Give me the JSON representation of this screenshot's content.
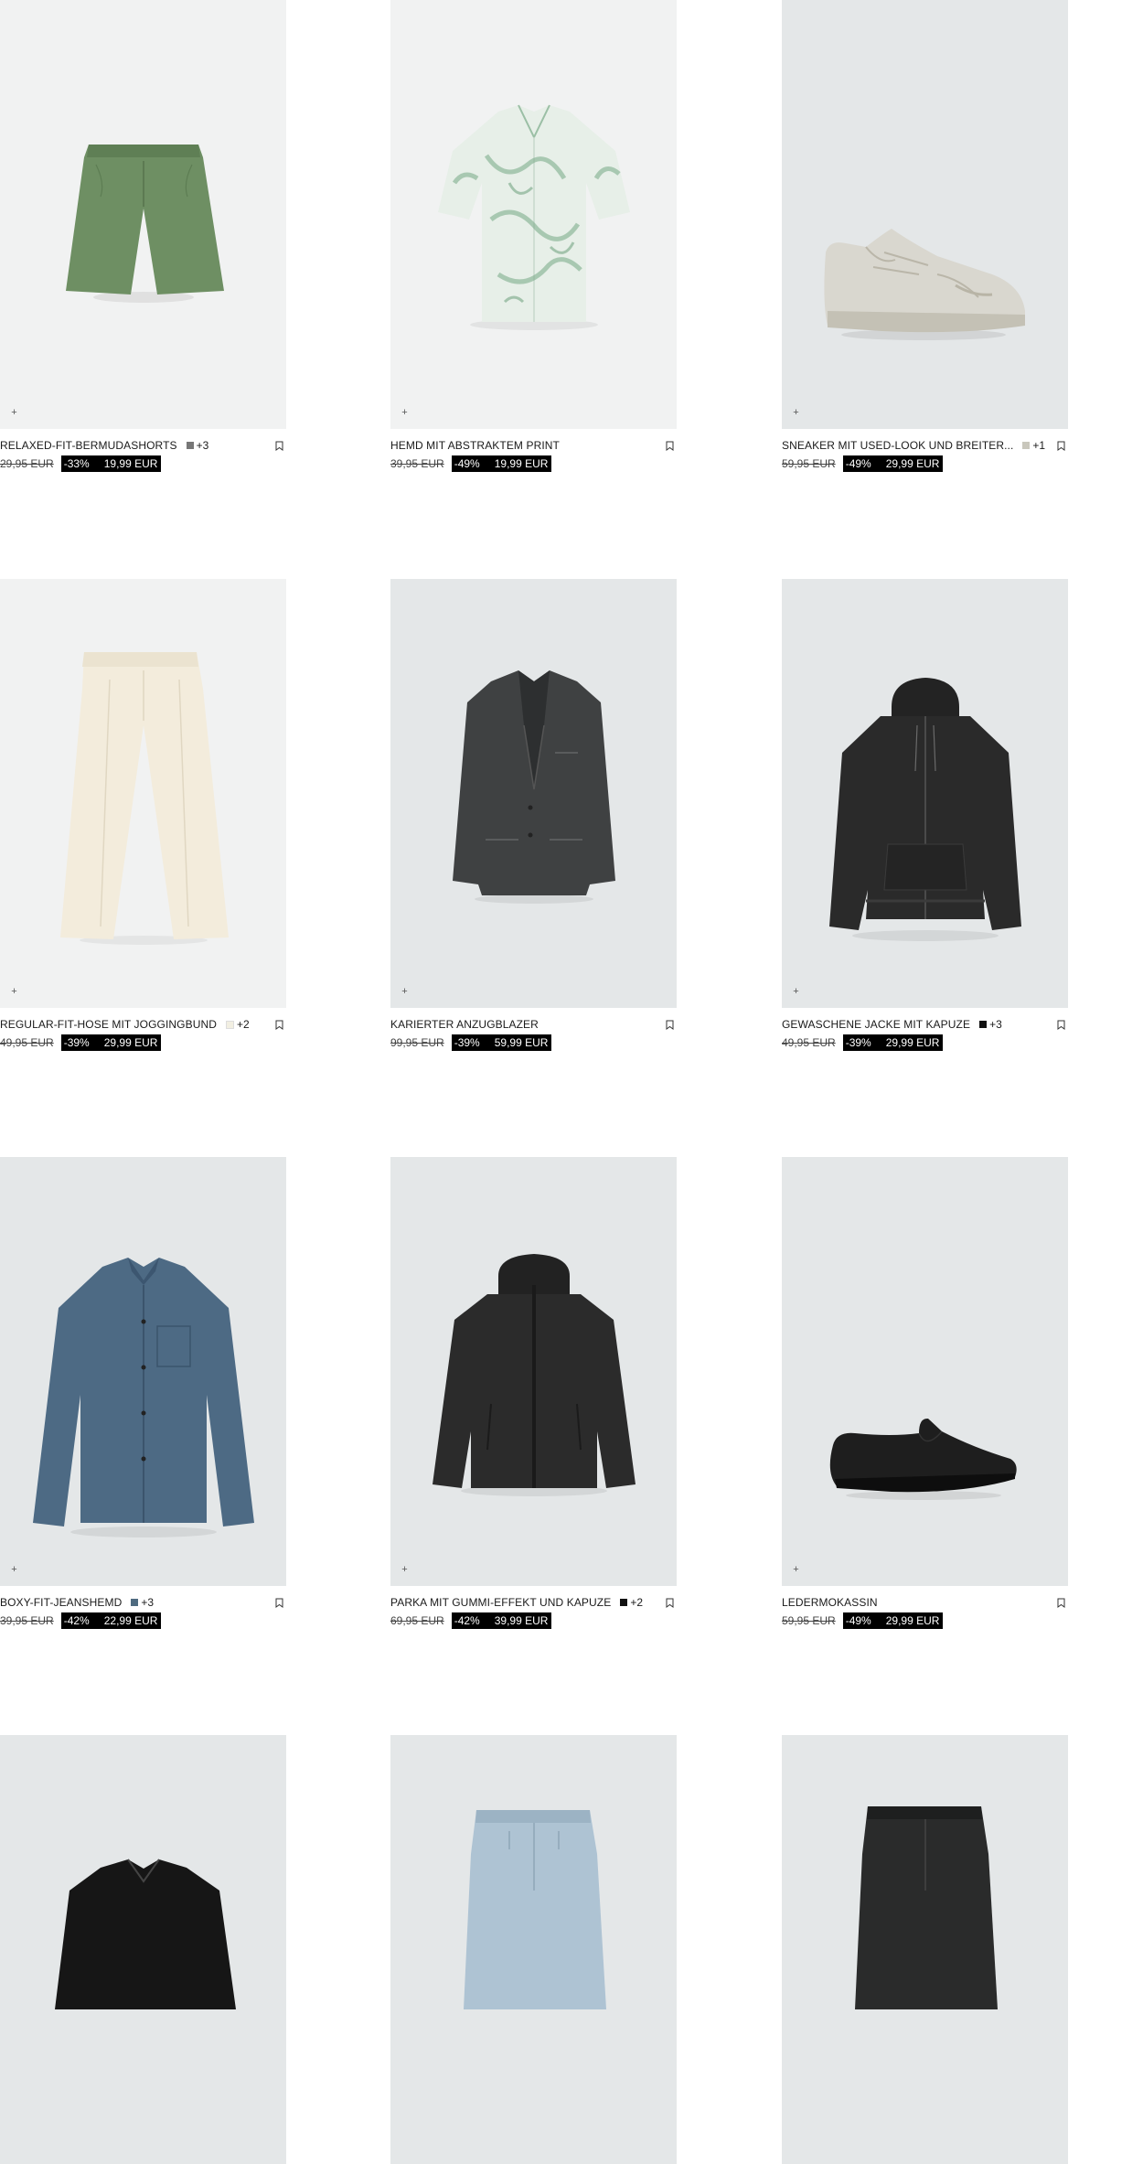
{
  "products": [
    {
      "name": "RELAXED-FIT-BERMUDASHORTS",
      "swatch": "#777777",
      "more": "+3",
      "old": "29,95 EUR",
      "disc": "-33%",
      "now": "19,99 EUR",
      "icon": "plus-icon"
    },
    {
      "name": "HEMD MIT ABSTRAKTEM PRINT",
      "swatch": "",
      "more": "",
      "old": "39,95 EUR",
      "disc": "-49%",
      "now": "19,99 EUR",
      "icon": "plus-icon"
    },
    {
      "name": "SNEAKER MIT USED-LOOK UND BREITER...",
      "swatch": "#c9c7bc",
      "more": "+1",
      "old": "59,95 EUR",
      "disc": "-49%",
      "now": "29,99 EUR",
      "icon": "plus-icon"
    },
    {
      "name": "REGULAR-FIT-HOSE MIT JOGGINGBUND",
      "swatch": "#f2efe2",
      "more": "+2",
      "old": "49,95 EUR",
      "disc": "-39%",
      "now": "29,99 EUR",
      "icon": "plus-icon"
    },
    {
      "name": "KARIERTER ANZUGBLAZER",
      "swatch": "",
      "more": "",
      "old": "99,95 EUR",
      "disc": "-39%",
      "now": "59,99 EUR",
      "icon": "plus-icon"
    },
    {
      "name": "GEWASCHENE JACKE MIT KAPUZE",
      "swatch": "#111111",
      "more": "+3",
      "old": "49,95 EUR",
      "disc": "-39%",
      "now": "29,99 EUR",
      "icon": "plus-icon"
    },
    {
      "name": "BOXY-FIT-JEANSHEMD",
      "swatch": "#4f6b80",
      "more": "+3",
      "old": "39,95 EUR",
      "disc": "-42%",
      "now": "22,99 EUR",
      "icon": "plus-icon"
    },
    {
      "name": "PARKA MIT GUMMI-EFFEKT UND KAPUZE",
      "swatch": "#111111",
      "more": "+2",
      "old": "69,95 EUR",
      "disc": "-42%",
      "now": "39,99 EUR",
      "icon": "plus-icon"
    },
    {
      "name": "LEDERMOKASSIN",
      "swatch": "",
      "more": "",
      "old": "59,95 EUR",
      "disc": "-49%",
      "now": "29,99 EUR",
      "icon": "plus-icon"
    }
  ],
  "colors": {
    "accent": "#000000",
    "background": "#ffffff"
  }
}
